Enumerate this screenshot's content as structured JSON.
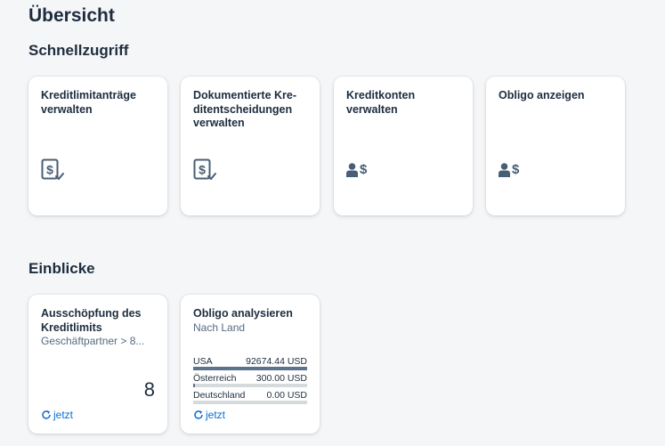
{
  "page": {
    "title": "Übersicht"
  },
  "sections": {
    "quick_access": "Schnellzugriff",
    "insights": "Einblicke"
  },
  "quick_tiles": [
    {
      "title": "Kreditlimitanträge\nverwalten",
      "icon": "document-dollar-check-icon"
    },
    {
      "title": "Dokumentierte Kre-\nditentscheidungen\nverwalten",
      "icon": "document-dollar-check-icon"
    },
    {
      "title": "Kreditkonten\nverwalten",
      "icon": "person-dollar-icon",
      "icon_text": "$"
    },
    {
      "title": "Obligo anzeigen",
      "icon": "person-dollar-icon",
      "icon_text": "$"
    }
  ],
  "insight_tiles": [
    {
      "title": "Ausschöpfung des\nKreditlimits",
      "subtitle": "Geschäftpartner > 8...",
      "value": "8",
      "refresh_label": "jetzt"
    },
    {
      "title": "Obligo analysieren",
      "subtitle": "Nach Land",
      "rows": [
        {
          "label": "USA",
          "value": "92674.44 USD",
          "fraction": 1.0
        },
        {
          "label": "Österreich",
          "value": "300.00 USD",
          "fraction": 0.0032
        },
        {
          "label": "Deutschland",
          "value": "0.00 USD",
          "fraction": 0.0
        }
      ],
      "refresh_label": "jetzt"
    }
  ],
  "colors": {
    "background": "#f5f6f7",
    "text": "#1d2d3e",
    "icon": "#475e75",
    "link": "#0a6ed1",
    "bar_fill": "#5b738b",
    "bar_track": "#d5dadd"
  }
}
